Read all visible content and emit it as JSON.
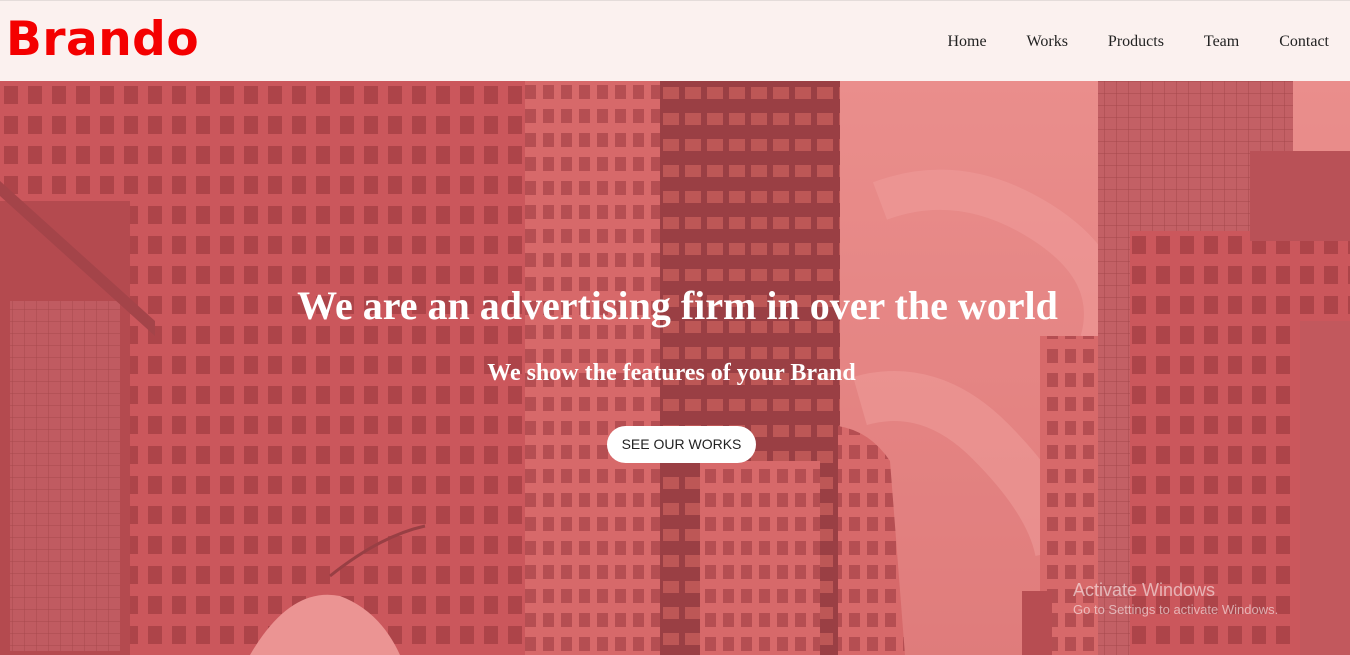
{
  "brand": {
    "name": "Brando",
    "color": "#f40000"
  },
  "nav": {
    "items": [
      "Home",
      "Works",
      "Products",
      "Team",
      "Contact"
    ]
  },
  "hero": {
    "headline": "We are an advertising firm in over the world",
    "subheadline": "We show the features of your Brand",
    "cta_label": "SEE OUR WORKS",
    "overlay_color": "#ee696e",
    "background_image": "city-buildings"
  },
  "watermark": {
    "title": "Activate Windows",
    "subtitle": "Go to Settings to activate Windows."
  }
}
